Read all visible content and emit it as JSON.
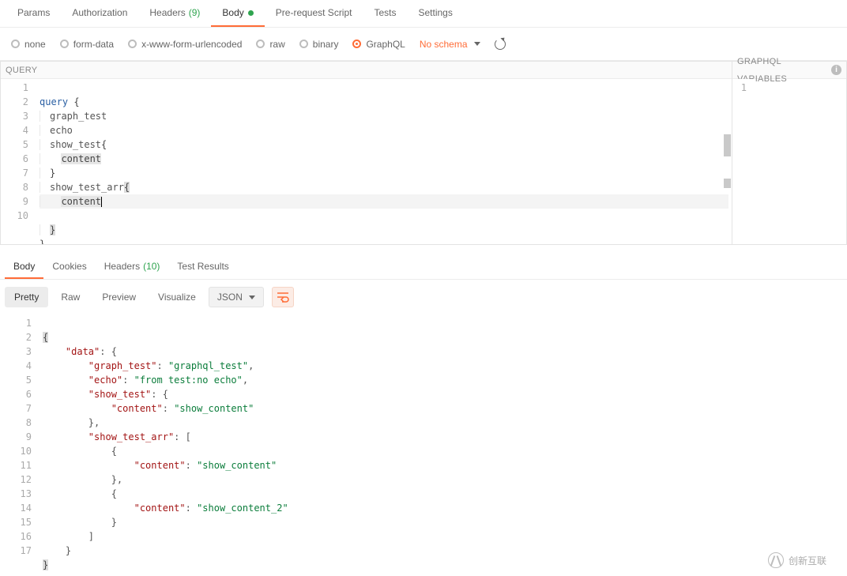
{
  "request_tabs": [
    {
      "label": "Params",
      "active": false
    },
    {
      "label": "Authorization",
      "active": false
    },
    {
      "label": "Headers",
      "count": "(9)",
      "active": false
    },
    {
      "label": "Body",
      "active": true,
      "dot": true
    },
    {
      "label": "Pre-request Script",
      "active": false
    },
    {
      "label": "Tests",
      "active": false
    },
    {
      "label": "Settings",
      "active": false
    }
  ],
  "body_types": [
    {
      "label": "none",
      "on": false
    },
    {
      "label": "form-data",
      "on": false
    },
    {
      "label": "x-www-form-urlencoded",
      "on": false
    },
    {
      "label": "raw",
      "on": false
    },
    {
      "label": "binary",
      "on": false
    },
    {
      "label": "GraphQL",
      "on": true
    }
  ],
  "schema_text": "No schema",
  "query_title": "QUERY",
  "vars_title": "GRAPHQL VARIABLES",
  "query_lines": [
    "1",
    "2",
    "3",
    "4",
    "5",
    "6",
    "7",
    "8",
    "9",
    "10"
  ],
  "query": {
    "l1_kw": "query",
    "l1_brace": "{",
    "l2": "graph_test",
    "l3": "echo",
    "l4": "show_test",
    "l4_brace": "{",
    "l5": "content",
    "l6": "}",
    "l7": "show_test_arr",
    "l7_brace": "{",
    "l8": "content",
    "l9": "}",
    "l10": "}"
  },
  "vars_lines": [
    "1"
  ],
  "response_tabs": [
    {
      "label": "Body",
      "active": true
    },
    {
      "label": "Cookies",
      "active": false
    },
    {
      "label": "Headers",
      "count": "(10)",
      "active": false
    },
    {
      "label": "Test Results",
      "active": false
    }
  ],
  "resp_modes": [
    {
      "label": "Pretty",
      "active": true
    },
    {
      "label": "Raw",
      "active": false
    },
    {
      "label": "Preview",
      "active": false
    },
    {
      "label": "Visualize",
      "active": false
    }
  ],
  "resp_format": "JSON",
  "resp_lines": [
    "1",
    "2",
    "3",
    "4",
    "5",
    "6",
    "7",
    "8",
    "9",
    "10",
    "11",
    "12",
    "13",
    "14",
    "15",
    "16",
    "17"
  ],
  "response": {
    "k_data": "\"data\"",
    "k_graph": "\"graph_test\"",
    "v_graph": "\"graphql_test\"",
    "k_echo": "\"echo\"",
    "v_echo": "\"from test:no echo\"",
    "k_show": "\"show_test\"",
    "k_content": "\"content\"",
    "v_content": "\"show_content\"",
    "k_show_arr": "\"show_test_arr\"",
    "v_content2": "\"show_content_2\""
  },
  "watermark": "创新互联"
}
